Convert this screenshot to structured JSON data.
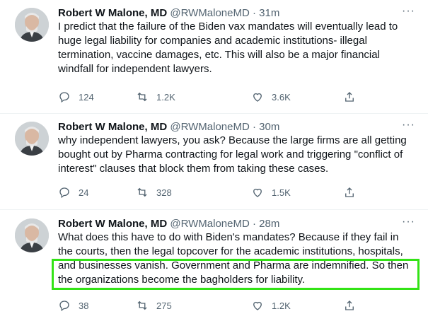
{
  "tweets": [
    {
      "author_name": "Robert W Malone, MD",
      "handle": "@RWMaloneMD",
      "separator": "·",
      "time": "31m",
      "more": "···",
      "lines": [
        "I predict that the failure of the Biden vax mandates will eventually lead to",
        "huge legal liability for companies and academic institutions- illegal",
        "termination, vaccine damages, etc.  This will also be a major financial",
        "windfall for independent lawyers."
      ],
      "replies": "124",
      "retweets": "1.2K",
      "likes": "3.6K"
    },
    {
      "author_name": "Robert W Malone, MD",
      "handle": "@RWMaloneMD",
      "separator": "·",
      "time": "30m",
      "more": "···",
      "lines": [
        "why independent lawyers, you ask?  Because the large firms are all getting",
        "bought out by Pharma contracting for legal work and triggering \"conflict of",
        "interest\" clauses that block them from taking these cases."
      ],
      "replies": "24",
      "retweets": "328",
      "likes": "1.5K"
    },
    {
      "author_name": "Robert W Malone, MD",
      "handle": "@RWMaloneMD",
      "separator": "·",
      "time": "28m",
      "more": "···",
      "lines": [
        "What does this have to do with Biden's mandates?  Because if they fail in",
        "the courts, then the legal topcover for the academic institutions, hospitals,",
        "and businesses vanish.  Government and Pharma are indemnified. So then",
        "the organizations become the bagholders for liability."
      ],
      "replies": "38",
      "retweets": "275",
      "likes": "1.2K"
    }
  ],
  "colors": {
    "text": "#0f1419",
    "secondary": "#536471",
    "highlight_border": "#33e316"
  }
}
